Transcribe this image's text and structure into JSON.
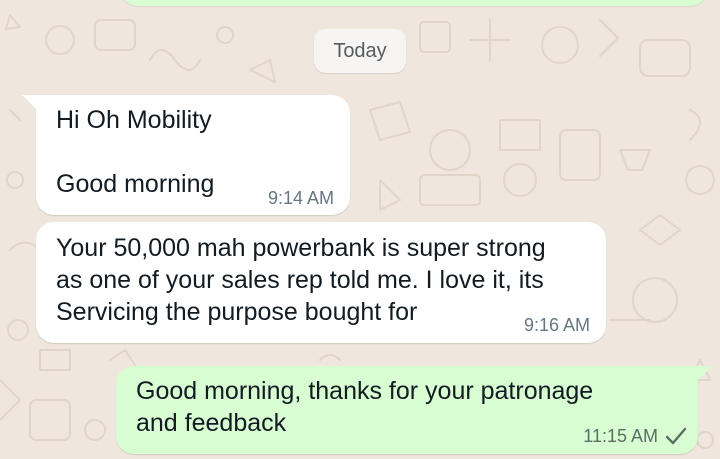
{
  "chat": {
    "date_divider": "Today",
    "messages": [
      {
        "direction": "incoming",
        "text": "Hi Oh Mobility\n\nGood morning",
        "time": "9:14 AM"
      },
      {
        "direction": "incoming",
        "text": "Your 50,000 mah powerbank is super strong\nas one of your sales rep told me. I love it, its\nServicing the purpose bought for",
        "time": "9:16 AM"
      },
      {
        "direction": "outgoing",
        "text": "Good morning, thanks for your patronage\nand feedback",
        "time": "11:15 AM",
        "status_icon": "single-check-icon"
      }
    ]
  },
  "colors": {
    "wallpaper": "#efe7dd",
    "incoming_bubble": "#ffffff",
    "outgoing_bubble": "#d9fdd3",
    "timestamp": "#667781"
  }
}
